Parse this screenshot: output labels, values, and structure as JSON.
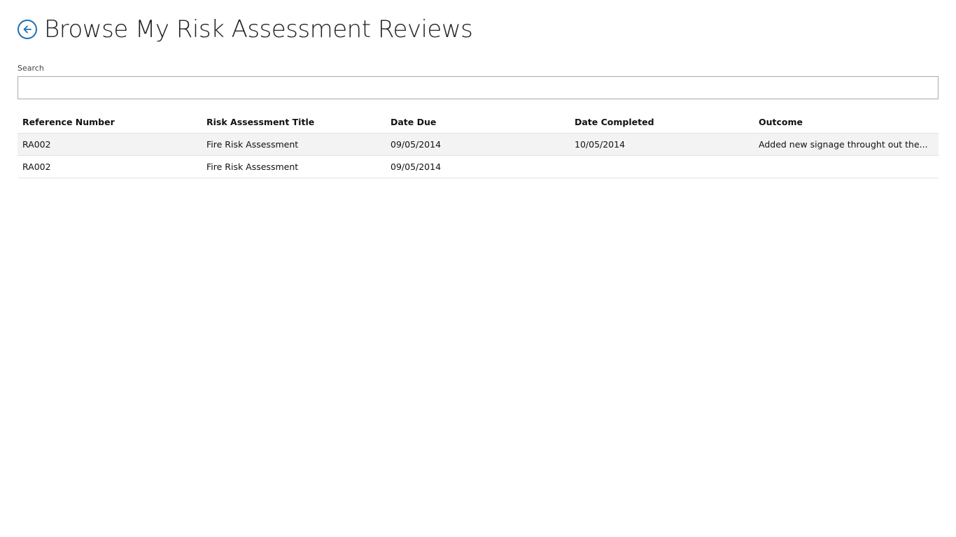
{
  "header": {
    "title": "Browse My Risk Assessment Reviews",
    "back_icon": "arrow-left-circle-icon",
    "accent_color": "#1f6fb2"
  },
  "search": {
    "label": "Search",
    "value": "",
    "placeholder": ""
  },
  "table": {
    "columns": [
      "Reference Number",
      "Risk Assessment Title",
      "Date Due",
      "Date Completed",
      "Outcome"
    ],
    "rows": [
      [
        "RA002",
        "Fire Risk Assessment",
        "09/05/2014",
        "10/05/2014",
        "Added new signage throught out the..."
      ],
      [
        "RA002",
        "Fire Risk Assessment",
        "09/05/2014",
        "",
        ""
      ]
    ]
  }
}
